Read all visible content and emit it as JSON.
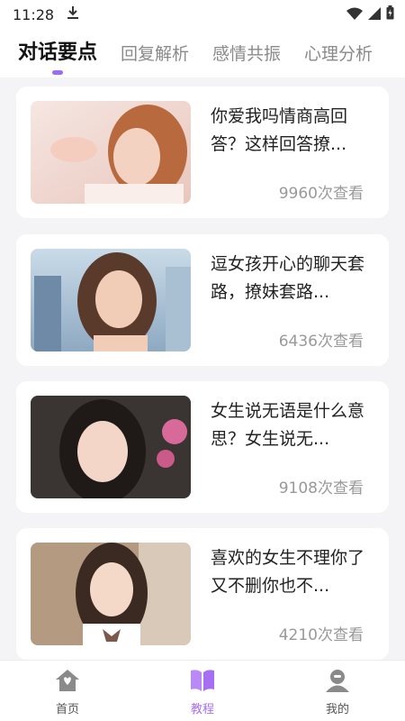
{
  "status_bar": {
    "time": "11:28",
    "download_icon": "download-icon",
    "wifi_icon": "wifi-icon",
    "signal_icon": "signal-icon",
    "battery_icon": "battery-icon"
  },
  "tabs": [
    {
      "label": "对话要点",
      "active": true
    },
    {
      "label": "回复解析",
      "active": false
    },
    {
      "label": "感情共振",
      "active": false
    },
    {
      "label": "心理分析",
      "active": false
    }
  ],
  "accent_color": "#9b6bff",
  "articles": [
    {
      "title": "你爱我吗情商高回答？这样回答撩...",
      "views": "9960次查看",
      "image": "woman-portrait-photo"
    },
    {
      "title": "逗女孩开心的聊天套路，撩妹套路...",
      "views": "6436次查看",
      "image": "woman-portrait-photo"
    },
    {
      "title": "女生说无语是什么意思？女生说无...",
      "views": "9108次查看",
      "image": "woman-portrait-photo"
    },
    {
      "title": "喜欢的女生不理你了又不删你也不...",
      "views": "4210次查看",
      "image": "woman-portrait-photo"
    }
  ],
  "bottom_nav": [
    {
      "label": "首页",
      "icon": "home-icon",
      "active": false
    },
    {
      "label": "教程",
      "icon": "book-icon",
      "active": true
    },
    {
      "label": "我的",
      "icon": "user-icon",
      "active": false
    }
  ]
}
